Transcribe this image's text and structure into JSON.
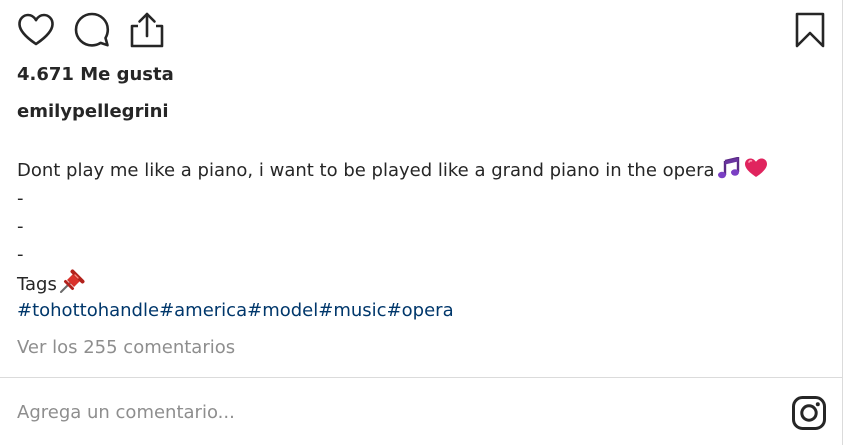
{
  "post": {
    "likes_text": "4.671 Me gusta",
    "username": "emilypellegrini",
    "caption": {
      "line1": "Dont play me like a piano, i want to be played like a grand piano in the opera",
      "dash1": "-",
      "dash2": "-",
      "dash3": "-",
      "tags_label": "Tags",
      "hashtags": [
        "#tohottohandle",
        "#america",
        "#model",
        "#music",
        "#opera"
      ]
    },
    "view_comments": "Ver los 255 comentarios"
  },
  "comment_box": {
    "placeholder": "Agrega un comentario..."
  },
  "icons": {
    "like": "heart-icon",
    "comment": "comment-bubble-icon",
    "share": "share-upload-icon",
    "save": "bookmark-icon",
    "music": "musical-notes-emoji",
    "heart_emoji": "red-heart-emoji",
    "pin": "pushpin-emoji",
    "instagram": "instagram-logo-icon"
  },
  "colors": {
    "text": "#262626",
    "muted": "#8e8e8e",
    "hashtag": "#00376b",
    "divider": "#dbdbdb"
  }
}
